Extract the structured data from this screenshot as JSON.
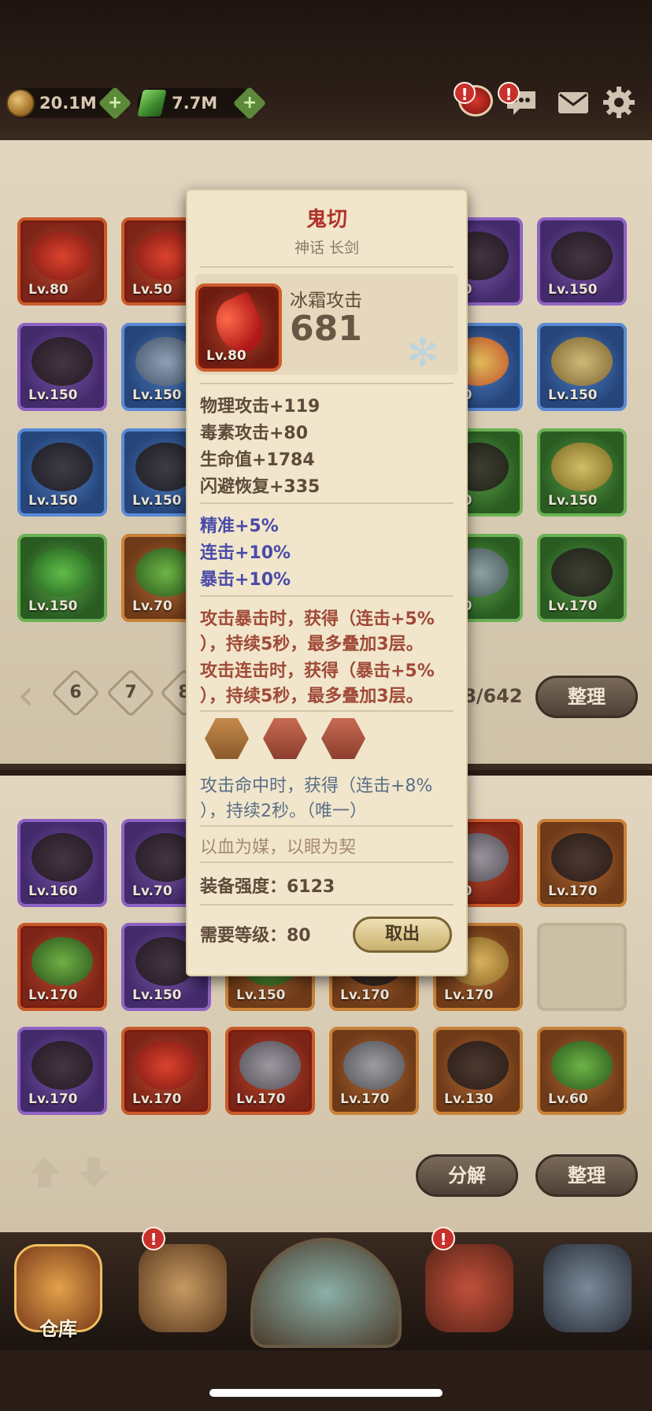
{
  "currency": {
    "gold": "20.1M",
    "gems": "7.7M"
  },
  "top_icons": {
    "alert_symbol": "!"
  },
  "grid_top": {
    "rows": [
      [
        {
          "lv": "Lv.80",
          "rarity": "red",
          "art": "red-blade"
        },
        {
          "lv": "Lv.50",
          "rarity": "red",
          "art": "red-blade"
        },
        {
          "lv": "",
          "rarity": "",
          "art": ""
        },
        {
          "lv": "",
          "rarity": "",
          "art": ""
        },
        {
          "lv": "150",
          "rarity": "purple",
          "art": "dark-armor"
        },
        {
          "lv": "Lv.150",
          "rarity": "purple",
          "art": "dark-gauntlet"
        }
      ],
      [
        {
          "lv": "Lv.150",
          "rarity": "purple",
          "art": "dark-gauntlet"
        },
        {
          "lv": "Lv.150",
          "rarity": "blue",
          "art": "sword"
        },
        {
          "lv": "",
          "rarity": "",
          "art": ""
        },
        {
          "lv": "",
          "rarity": "",
          "art": ""
        },
        {
          "lv": "150",
          "rarity": "blue",
          "art": "fire"
        },
        {
          "lv": "Lv.150",
          "rarity": "blue",
          "art": "fang-necklace"
        }
      ],
      [
        {
          "lv": "Lv.150",
          "rarity": "blue",
          "art": "purple-glove"
        },
        {
          "lv": "Lv.150",
          "rarity": "blue",
          "art": "spiked-boot"
        },
        {
          "lv": "",
          "rarity": "",
          "art": ""
        },
        {
          "lv": "",
          "rarity": "",
          "art": ""
        },
        {
          "lv": "150",
          "rarity": "green",
          "art": "hood"
        },
        {
          "lv": "Lv.150",
          "rarity": "green",
          "art": "gold-amulet"
        }
      ],
      [
        {
          "lv": "Lv.150",
          "rarity": "green",
          "art": "green-amulet"
        },
        {
          "lv": "Lv.70",
          "rarity": "orange",
          "art": "green-orb"
        },
        {
          "lv": "",
          "rarity": "",
          "art": ""
        },
        {
          "lv": "",
          "rarity": "",
          "art": ""
        },
        {
          "lv": "150",
          "rarity": "green",
          "art": "steel-boot"
        },
        {
          "lv": "Lv.170",
          "rarity": "green",
          "art": "brown-boot"
        }
      ]
    ]
  },
  "pagination": {
    "prev": "‹",
    "pages": [
      "6",
      "7",
      "8"
    ],
    "count": "8/642",
    "sort_label": "整理"
  },
  "grid_bottom": {
    "rows": [
      [
        {
          "lv": "Lv.160",
          "rarity": "purple",
          "art": "shield-card"
        },
        {
          "lv": "Lv.70",
          "rarity": "purple",
          "art": "spiked-helm"
        },
        {
          "lv": "",
          "rarity": "",
          "art": ""
        },
        {
          "lv": "",
          "rarity": "",
          "art": ""
        },
        {
          "lv": "170",
          "rarity": "red",
          "art": "armor"
        },
        {
          "lv": "Lv.170",
          "rarity": "orange",
          "art": "mace"
        }
      ],
      [
        {
          "lv": "Lv.170",
          "rarity": "red",
          "art": "green-orb"
        },
        {
          "lv": "Lv.150",
          "rarity": "purple",
          "art": "dark-gauntlet"
        },
        {
          "lv": "Lv.150",
          "rarity": "orange",
          "art": "green-orb"
        },
        {
          "lv": "Lv.170",
          "rarity": "orange",
          "art": "claw"
        },
        {
          "lv": "Lv.170",
          "rarity": "orange",
          "art": "snail"
        },
        {
          "lv": "",
          "rarity": "empty",
          "art": ""
        }
      ],
      [
        {
          "lv": "Lv.170",
          "rarity": "purple",
          "art": "ring"
        },
        {
          "lv": "Lv.170",
          "rarity": "red",
          "art": "red-blade"
        },
        {
          "lv": "Lv.170",
          "rarity": "red",
          "art": "blue-axe"
        },
        {
          "lv": "Lv.170",
          "rarity": "orange",
          "art": "steel-armor"
        },
        {
          "lv": "Lv.130",
          "rarity": "orange",
          "art": "spike-ball"
        },
        {
          "lv": "Lv.60",
          "rarity": "orange",
          "art": "green-orb"
        }
      ]
    ],
    "decompose_label": "分解",
    "sort_label": "整理"
  },
  "tooltip": {
    "name": "鬼切",
    "subtitle": "神话 长剑",
    "icon_lv": "Lv.80",
    "main_stat_label": "冰霜攻击",
    "main_stat_value": "681",
    "base_stats": [
      "物理攻击+119",
      "毒素攻击+80",
      "生命值+1784",
      "闪避恢复+335"
    ],
    "bonus_stats": [
      "精准+5%",
      "连击+10%",
      "暴击+10%"
    ],
    "effects": [
      "攻击暴击时，获得（连击+5%",
      "），持续5秒，最多叠加3层。",
      "攻击连击时，获得（暴击+5%",
      "），持续5秒，最多叠加3层。"
    ],
    "socket_effect": [
      "攻击命中时，获得（连击+8%",
      "），持续2秒。（唯一）"
    ],
    "flavor": "以血为媒，以眼为契",
    "power": "装备强度：6123",
    "required_level": "需要等级：80",
    "take_out_label": "取出"
  },
  "nav": {
    "warehouse_label": "仓库"
  },
  "colors": {
    "title_red": "#b0332a",
    "bonus_purple": "#4a4aa8",
    "effect_rust": "#a04a38",
    "socket_slate": "#5a6e86",
    "alert_red": "#c9302c"
  }
}
